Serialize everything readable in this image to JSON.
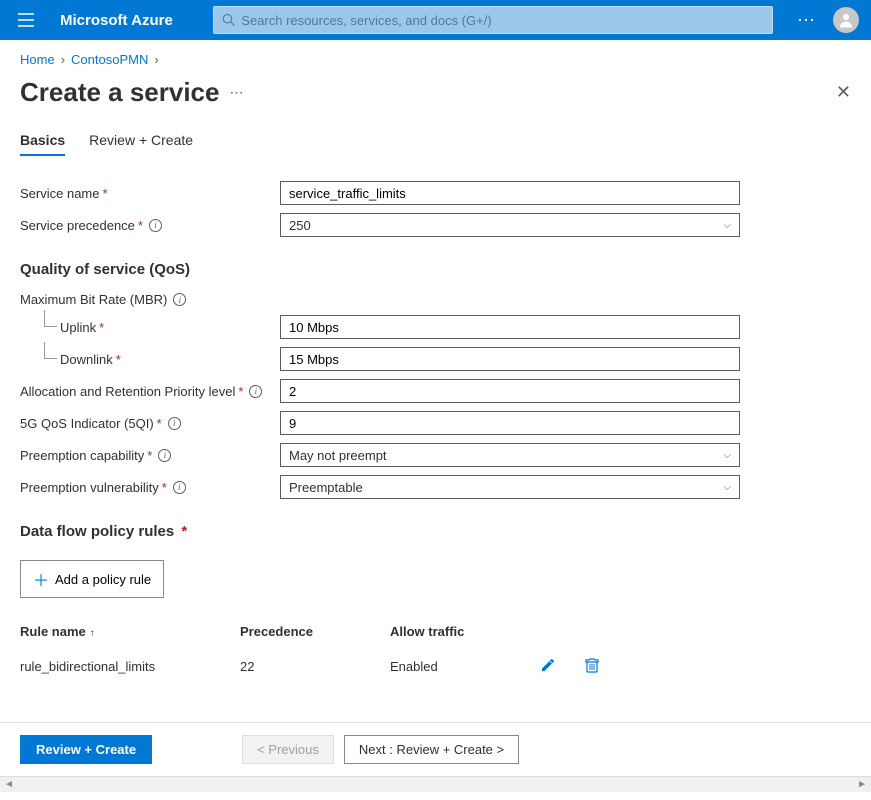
{
  "topbar": {
    "brand": "Microsoft Azure",
    "search_placeholder": "Search resources, services, and docs (G+/)"
  },
  "breadcrumb": {
    "home": "Home",
    "item": "ContosoPMN"
  },
  "page": {
    "title": "Create a service"
  },
  "tabs": {
    "basics": "Basics",
    "review": "Review + Create"
  },
  "labels": {
    "service_name": "Service name",
    "service_precedence": "Service precedence",
    "qos_heading": "Quality of service (QoS)",
    "mbr": "Maximum Bit Rate (MBR)",
    "uplink": "Uplink",
    "downlink": "Downlink",
    "arp": "Allocation and Retention Priority level",
    "fiveqi": "5G QoS Indicator (5QI)",
    "preempt_cap": "Preemption capability",
    "preempt_vul": "Preemption vulnerability",
    "rules_heading": "Data flow policy rules",
    "add_rule": "Add a policy rule"
  },
  "values": {
    "service_name": "service_traffic_limits",
    "service_precedence": "250",
    "uplink": "10 Mbps",
    "downlink": "15 Mbps",
    "arp": "2",
    "fiveqi": "9",
    "preempt_cap": "May not preempt",
    "preempt_vul": "Preemptable"
  },
  "rules_table": {
    "headers": {
      "name": "Rule name",
      "prec": "Precedence",
      "allow": "Allow traffic"
    },
    "row0": {
      "name": "rule_bidirectional_limits",
      "prec": "22",
      "allow": "Enabled"
    }
  },
  "footer": {
    "review": "Review + Create",
    "previous": "< Previous",
    "next": "Next : Review + Create >"
  }
}
